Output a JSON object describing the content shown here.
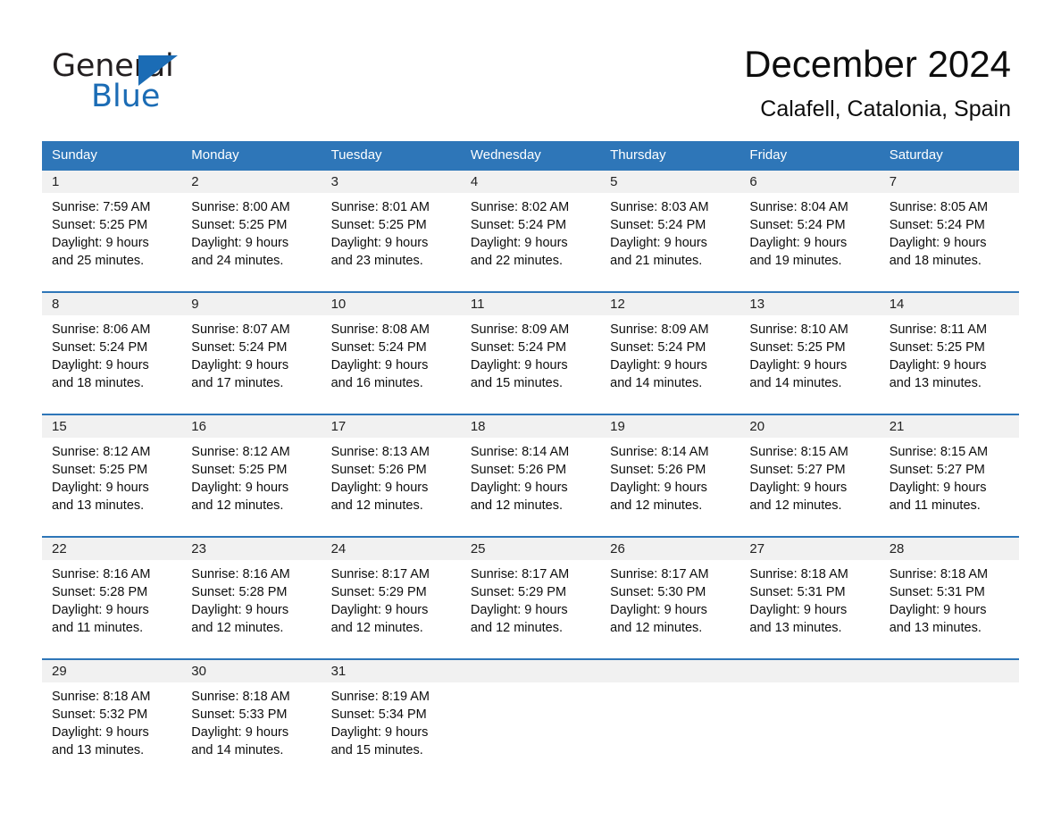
{
  "brand": {
    "logo_text_1": "General",
    "logo_text_2": "Blue",
    "logo_icon": "triangle-icon",
    "accent_color": "#1b6cb5"
  },
  "header": {
    "title": "December 2024",
    "subtitle": "Calafell, Catalonia, Spain"
  },
  "calendar": {
    "header_bg": "#2e76b8",
    "daynum_bg": "#f1f1f1",
    "weekdays": [
      "Sunday",
      "Monday",
      "Tuesday",
      "Wednesday",
      "Thursday",
      "Friday",
      "Saturday"
    ],
    "weeks": [
      [
        {
          "day": "1",
          "sunrise": "Sunrise: 7:59 AM",
          "sunset": "Sunset: 5:25 PM",
          "daylight1": "Daylight: 9 hours",
          "daylight2": "and 25 minutes."
        },
        {
          "day": "2",
          "sunrise": "Sunrise: 8:00 AM",
          "sunset": "Sunset: 5:25 PM",
          "daylight1": "Daylight: 9 hours",
          "daylight2": "and 24 minutes."
        },
        {
          "day": "3",
          "sunrise": "Sunrise: 8:01 AM",
          "sunset": "Sunset: 5:25 PM",
          "daylight1": "Daylight: 9 hours",
          "daylight2": "and 23 minutes."
        },
        {
          "day": "4",
          "sunrise": "Sunrise: 8:02 AM",
          "sunset": "Sunset: 5:24 PM",
          "daylight1": "Daylight: 9 hours",
          "daylight2": "and 22 minutes."
        },
        {
          "day": "5",
          "sunrise": "Sunrise: 8:03 AM",
          "sunset": "Sunset: 5:24 PM",
          "daylight1": "Daylight: 9 hours",
          "daylight2": "and 21 minutes."
        },
        {
          "day": "6",
          "sunrise": "Sunrise: 8:04 AM",
          "sunset": "Sunset: 5:24 PM",
          "daylight1": "Daylight: 9 hours",
          "daylight2": "and 19 minutes."
        },
        {
          "day": "7",
          "sunrise": "Sunrise: 8:05 AM",
          "sunset": "Sunset: 5:24 PM",
          "daylight1": "Daylight: 9 hours",
          "daylight2": "and 18 minutes."
        }
      ],
      [
        {
          "day": "8",
          "sunrise": "Sunrise: 8:06 AM",
          "sunset": "Sunset: 5:24 PM",
          "daylight1": "Daylight: 9 hours",
          "daylight2": "and 18 minutes."
        },
        {
          "day": "9",
          "sunrise": "Sunrise: 8:07 AM",
          "sunset": "Sunset: 5:24 PM",
          "daylight1": "Daylight: 9 hours",
          "daylight2": "and 17 minutes."
        },
        {
          "day": "10",
          "sunrise": "Sunrise: 8:08 AM",
          "sunset": "Sunset: 5:24 PM",
          "daylight1": "Daylight: 9 hours",
          "daylight2": "and 16 minutes."
        },
        {
          "day": "11",
          "sunrise": "Sunrise: 8:09 AM",
          "sunset": "Sunset: 5:24 PM",
          "daylight1": "Daylight: 9 hours",
          "daylight2": "and 15 minutes."
        },
        {
          "day": "12",
          "sunrise": "Sunrise: 8:09 AM",
          "sunset": "Sunset: 5:24 PM",
          "daylight1": "Daylight: 9 hours",
          "daylight2": "and 14 minutes."
        },
        {
          "day": "13",
          "sunrise": "Sunrise: 8:10 AM",
          "sunset": "Sunset: 5:25 PM",
          "daylight1": "Daylight: 9 hours",
          "daylight2": "and 14 minutes."
        },
        {
          "day": "14",
          "sunrise": "Sunrise: 8:11 AM",
          "sunset": "Sunset: 5:25 PM",
          "daylight1": "Daylight: 9 hours",
          "daylight2": "and 13 minutes."
        }
      ],
      [
        {
          "day": "15",
          "sunrise": "Sunrise: 8:12 AM",
          "sunset": "Sunset: 5:25 PM",
          "daylight1": "Daylight: 9 hours",
          "daylight2": "and 13 minutes."
        },
        {
          "day": "16",
          "sunrise": "Sunrise: 8:12 AM",
          "sunset": "Sunset: 5:25 PM",
          "daylight1": "Daylight: 9 hours",
          "daylight2": "and 12 minutes."
        },
        {
          "day": "17",
          "sunrise": "Sunrise: 8:13 AM",
          "sunset": "Sunset: 5:26 PM",
          "daylight1": "Daylight: 9 hours",
          "daylight2": "and 12 minutes."
        },
        {
          "day": "18",
          "sunrise": "Sunrise: 8:14 AM",
          "sunset": "Sunset: 5:26 PM",
          "daylight1": "Daylight: 9 hours",
          "daylight2": "and 12 minutes."
        },
        {
          "day": "19",
          "sunrise": "Sunrise: 8:14 AM",
          "sunset": "Sunset: 5:26 PM",
          "daylight1": "Daylight: 9 hours",
          "daylight2": "and 12 minutes."
        },
        {
          "day": "20",
          "sunrise": "Sunrise: 8:15 AM",
          "sunset": "Sunset: 5:27 PM",
          "daylight1": "Daylight: 9 hours",
          "daylight2": "and 12 minutes."
        },
        {
          "day": "21",
          "sunrise": "Sunrise: 8:15 AM",
          "sunset": "Sunset: 5:27 PM",
          "daylight1": "Daylight: 9 hours",
          "daylight2": "and 11 minutes."
        }
      ],
      [
        {
          "day": "22",
          "sunrise": "Sunrise: 8:16 AM",
          "sunset": "Sunset: 5:28 PM",
          "daylight1": "Daylight: 9 hours",
          "daylight2": "and 11 minutes."
        },
        {
          "day": "23",
          "sunrise": "Sunrise: 8:16 AM",
          "sunset": "Sunset: 5:28 PM",
          "daylight1": "Daylight: 9 hours",
          "daylight2": "and 12 minutes."
        },
        {
          "day": "24",
          "sunrise": "Sunrise: 8:17 AM",
          "sunset": "Sunset: 5:29 PM",
          "daylight1": "Daylight: 9 hours",
          "daylight2": "and 12 minutes."
        },
        {
          "day": "25",
          "sunrise": "Sunrise: 8:17 AM",
          "sunset": "Sunset: 5:29 PM",
          "daylight1": "Daylight: 9 hours",
          "daylight2": "and 12 minutes."
        },
        {
          "day": "26",
          "sunrise": "Sunrise: 8:17 AM",
          "sunset": "Sunset: 5:30 PM",
          "daylight1": "Daylight: 9 hours",
          "daylight2": "and 12 minutes."
        },
        {
          "day": "27",
          "sunrise": "Sunrise: 8:18 AM",
          "sunset": "Sunset: 5:31 PM",
          "daylight1": "Daylight: 9 hours",
          "daylight2": "and 13 minutes."
        },
        {
          "day": "28",
          "sunrise": "Sunrise: 8:18 AM",
          "sunset": "Sunset: 5:31 PM",
          "daylight1": "Daylight: 9 hours",
          "daylight2": "and 13 minutes."
        }
      ],
      [
        {
          "day": "29",
          "sunrise": "Sunrise: 8:18 AM",
          "sunset": "Sunset: 5:32 PM",
          "daylight1": "Daylight: 9 hours",
          "daylight2": "and 13 minutes."
        },
        {
          "day": "30",
          "sunrise": "Sunrise: 8:18 AM",
          "sunset": "Sunset: 5:33 PM",
          "daylight1": "Daylight: 9 hours",
          "daylight2": "and 14 minutes."
        },
        {
          "day": "31",
          "sunrise": "Sunrise: 8:19 AM",
          "sunset": "Sunset: 5:34 PM",
          "daylight1": "Daylight: 9 hours",
          "daylight2": "and 15 minutes."
        },
        {
          "day": "",
          "sunrise": "",
          "sunset": "",
          "daylight1": "",
          "daylight2": ""
        },
        {
          "day": "",
          "sunrise": "",
          "sunset": "",
          "daylight1": "",
          "daylight2": ""
        },
        {
          "day": "",
          "sunrise": "",
          "sunset": "",
          "daylight1": "",
          "daylight2": ""
        },
        {
          "day": "",
          "sunrise": "",
          "sunset": "",
          "daylight1": "",
          "daylight2": ""
        }
      ]
    ]
  }
}
